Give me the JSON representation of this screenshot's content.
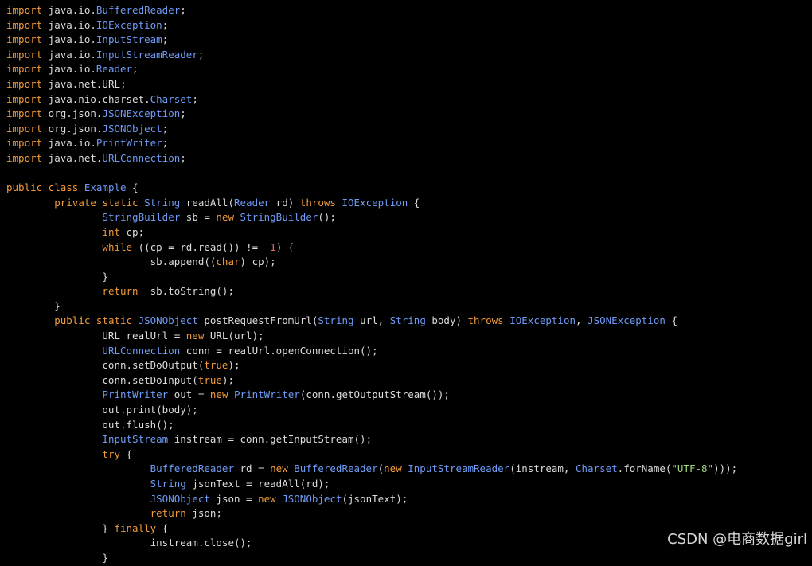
{
  "colors": {
    "background": "#000000",
    "text": "#dcdcdc",
    "keyword": "#f29b3a",
    "type": "#6f9bf5",
    "string": "#9fd67a",
    "number": "#f06868"
  },
  "code_lines": [
    [
      {
        "t": "import",
        "c": "kw"
      },
      {
        "t": " java.io."
      },
      {
        "t": "BufferedReader",
        "c": "ty"
      },
      {
        "t": ";"
      }
    ],
    [
      {
        "t": "import",
        "c": "kw"
      },
      {
        "t": " java.io."
      },
      {
        "t": "IOException",
        "c": "ty"
      },
      {
        "t": ";"
      }
    ],
    [
      {
        "t": "import",
        "c": "kw"
      },
      {
        "t": " java.io."
      },
      {
        "t": "InputStream",
        "c": "ty"
      },
      {
        "t": ";"
      }
    ],
    [
      {
        "t": "import",
        "c": "kw"
      },
      {
        "t": " java.io."
      },
      {
        "t": "InputStreamReader",
        "c": "ty"
      },
      {
        "t": ";"
      }
    ],
    [
      {
        "t": "import",
        "c": "kw"
      },
      {
        "t": " java.io."
      },
      {
        "t": "Reader",
        "c": "ty"
      },
      {
        "t": ";"
      }
    ],
    [
      {
        "t": "import",
        "c": "kw"
      },
      {
        "t": " java.net.URL;"
      }
    ],
    [
      {
        "t": "import",
        "c": "kw"
      },
      {
        "t": " java.nio.charset."
      },
      {
        "t": "Charset",
        "c": "ty"
      },
      {
        "t": ";"
      }
    ],
    [
      {
        "t": "import",
        "c": "kw"
      },
      {
        "t": " org.json."
      },
      {
        "t": "JSONException",
        "c": "ty"
      },
      {
        "t": ";"
      }
    ],
    [
      {
        "t": "import",
        "c": "kw"
      },
      {
        "t": " org.json."
      },
      {
        "t": "JSONObject",
        "c": "ty"
      },
      {
        "t": ";"
      }
    ],
    [
      {
        "t": "import",
        "c": "kw"
      },
      {
        "t": " java.io."
      },
      {
        "t": "PrintWriter",
        "c": "ty"
      },
      {
        "t": ";"
      }
    ],
    [
      {
        "t": "import",
        "c": "kw"
      },
      {
        "t": " java.net."
      },
      {
        "t": "URLConnection",
        "c": "ty"
      },
      {
        "t": ";"
      }
    ],
    [],
    [
      {
        "t": "public class",
        "c": "kw"
      },
      {
        "t": " "
      },
      {
        "t": "Example",
        "c": "ty"
      },
      {
        "t": " {"
      }
    ],
    [
      {
        "t": "        "
      },
      {
        "t": "private static",
        "c": "kw"
      },
      {
        "t": " "
      },
      {
        "t": "String",
        "c": "ty"
      },
      {
        "t": " readAll("
      },
      {
        "t": "Reader",
        "c": "ty"
      },
      {
        "t": " rd) "
      },
      {
        "t": "throws",
        "c": "kw"
      },
      {
        "t": " "
      },
      {
        "t": "IOException",
        "c": "ty"
      },
      {
        "t": " {"
      }
    ],
    [
      {
        "t": "                "
      },
      {
        "t": "StringBuilder",
        "c": "ty"
      },
      {
        "t": " sb = "
      },
      {
        "t": "new",
        "c": "kw"
      },
      {
        "t": " "
      },
      {
        "t": "StringBuilder",
        "c": "ty"
      },
      {
        "t": "();"
      }
    ],
    [
      {
        "t": "                "
      },
      {
        "t": "int",
        "c": "kw"
      },
      {
        "t": " cp;"
      }
    ],
    [
      {
        "t": "                "
      },
      {
        "t": "while",
        "c": "kw"
      },
      {
        "t": " ((cp = rd.read()) != "
      },
      {
        "t": "-1",
        "c": "num"
      },
      {
        "t": ") {"
      }
    ],
    [
      {
        "t": "                        sb.append(("
      },
      {
        "t": "char",
        "c": "kw"
      },
      {
        "t": ") cp);"
      }
    ],
    [
      {
        "t": "                }"
      }
    ],
    [
      {
        "t": "                "
      },
      {
        "t": "return",
        "c": "kw"
      },
      {
        "t": "  sb.toString();"
      }
    ],
    [
      {
        "t": "        }"
      }
    ],
    [
      {
        "t": "        "
      },
      {
        "t": "public static",
        "c": "kw"
      },
      {
        "t": " "
      },
      {
        "t": "JSONObject",
        "c": "ty"
      },
      {
        "t": " postRequestFromUrl("
      },
      {
        "t": "String",
        "c": "ty"
      },
      {
        "t": " url, "
      },
      {
        "t": "String",
        "c": "ty"
      },
      {
        "t": " body) "
      },
      {
        "t": "throws",
        "c": "kw"
      },
      {
        "t": " "
      },
      {
        "t": "IOException",
        "c": "ty"
      },
      {
        "t": ", "
      },
      {
        "t": "JSONException",
        "c": "ty"
      },
      {
        "t": " {"
      }
    ],
    [
      {
        "t": "                URL realUrl = "
      },
      {
        "t": "new",
        "c": "kw"
      },
      {
        "t": " URL(url);"
      }
    ],
    [
      {
        "t": "                "
      },
      {
        "t": "URLConnection",
        "c": "ty"
      },
      {
        "t": " conn = realUrl.openConnection();"
      }
    ],
    [
      {
        "t": "                conn.setDoOutput("
      },
      {
        "t": "true",
        "c": "kw"
      },
      {
        "t": ");"
      }
    ],
    [
      {
        "t": "                conn.setDoInput("
      },
      {
        "t": "true",
        "c": "kw"
      },
      {
        "t": ");"
      }
    ],
    [
      {
        "t": "                "
      },
      {
        "t": "PrintWriter",
        "c": "ty"
      },
      {
        "t": " out = "
      },
      {
        "t": "new",
        "c": "kw"
      },
      {
        "t": " "
      },
      {
        "t": "PrintWriter",
        "c": "ty"
      },
      {
        "t": "(conn.getOutputStream());"
      }
    ],
    [
      {
        "t": "                out.print(body);"
      }
    ],
    [
      {
        "t": "                out.flush();"
      }
    ],
    [
      {
        "t": "                "
      },
      {
        "t": "InputStream",
        "c": "ty"
      },
      {
        "t": " instream = conn.getInputStream();"
      }
    ],
    [
      {
        "t": "                "
      },
      {
        "t": "try",
        "c": "kw"
      },
      {
        "t": " {"
      }
    ],
    [
      {
        "t": "                        "
      },
      {
        "t": "BufferedReader",
        "c": "ty"
      },
      {
        "t": " rd = "
      },
      {
        "t": "new",
        "c": "kw"
      },
      {
        "t": " "
      },
      {
        "t": "BufferedReader",
        "c": "ty"
      },
      {
        "t": "("
      },
      {
        "t": "new",
        "c": "kw"
      },
      {
        "t": " "
      },
      {
        "t": "InputStreamReader",
        "c": "ty"
      },
      {
        "t": "(instream, "
      },
      {
        "t": "Charset",
        "c": "ty"
      },
      {
        "t": ".forName("
      },
      {
        "t": "\"UTF-8\"",
        "c": "str"
      },
      {
        "t": ")));"
      }
    ],
    [
      {
        "t": "                        "
      },
      {
        "t": "String",
        "c": "ty"
      },
      {
        "t": " jsonText = readAll(rd);"
      }
    ],
    [
      {
        "t": "                        "
      },
      {
        "t": "JSONObject",
        "c": "ty"
      },
      {
        "t": " json = "
      },
      {
        "t": "new",
        "c": "kw"
      },
      {
        "t": " "
      },
      {
        "t": "JSONObject",
        "c": "ty"
      },
      {
        "t": "(jsonText);"
      }
    ],
    [
      {
        "t": "                        "
      },
      {
        "t": "return",
        "c": "kw"
      },
      {
        "t": " json;"
      }
    ],
    [
      {
        "t": "                } "
      },
      {
        "t": "finally",
        "c": "kw"
      },
      {
        "t": " {"
      }
    ],
    [
      {
        "t": "                        instream.close();"
      }
    ],
    [
      {
        "t": "                }"
      }
    ]
  ],
  "watermark": "CSDN @电商数据girl"
}
